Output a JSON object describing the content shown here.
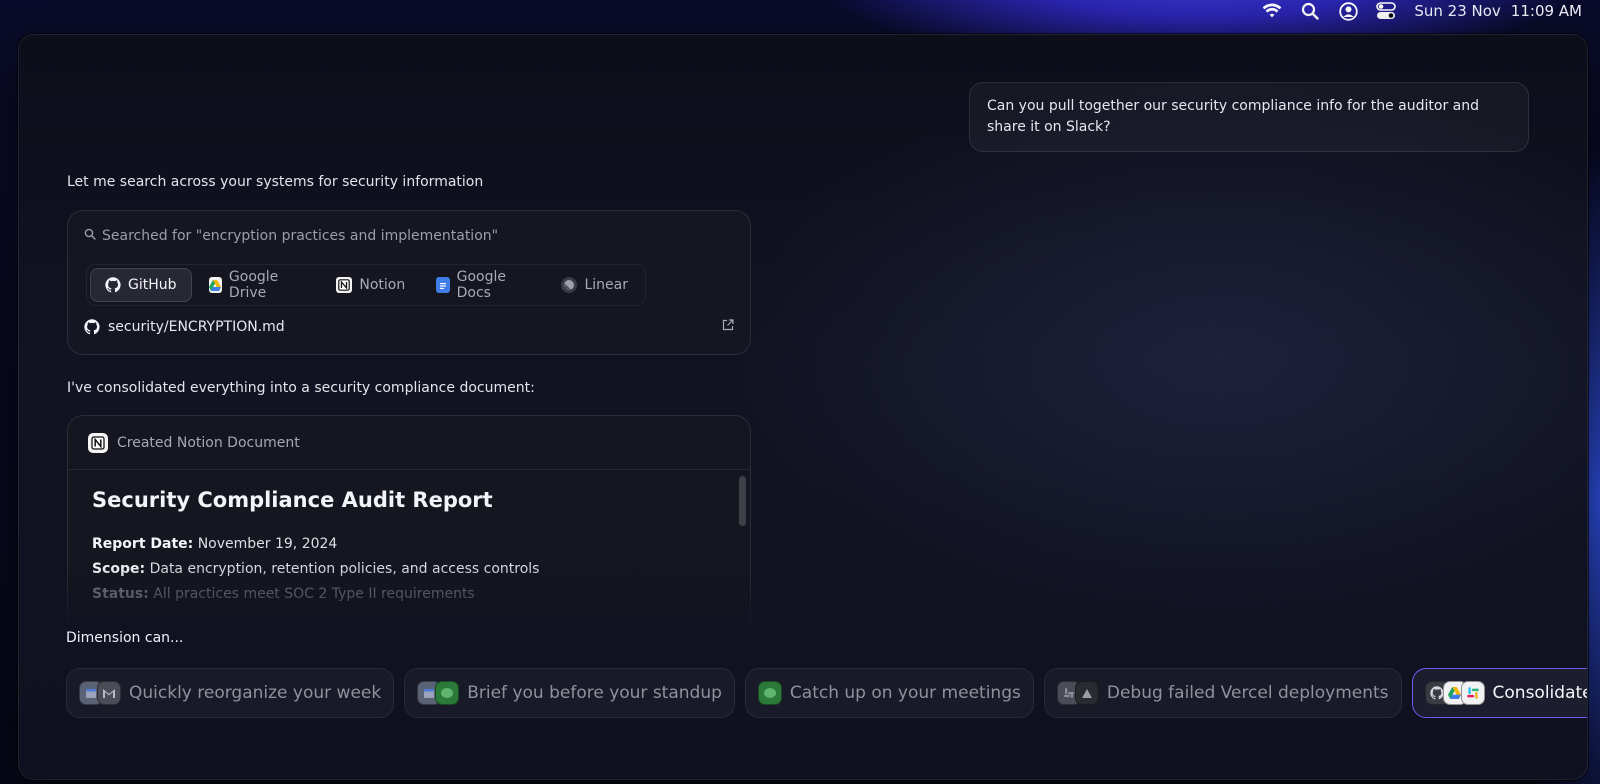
{
  "menubar": {
    "date": "Sun 23 Nov",
    "time": "11:09 AM"
  },
  "chat": {
    "user_message": "Can you pull together our security compliance info for the auditor and share it on Slack?",
    "assistant_intro": "Let me search across your systems for security information",
    "search": {
      "query_text": "Searched for \"encryption practices and implementation\"",
      "sources": [
        {
          "label": "GitHub",
          "icon": "github-icon",
          "active": true
        },
        {
          "label": "Google Drive",
          "icon": "google-drive-icon",
          "active": false
        },
        {
          "label": "Notion",
          "icon": "notion-icon",
          "active": false
        },
        {
          "label": "Google Docs",
          "icon": "google-docs-icon",
          "active": false
        },
        {
          "label": "Linear",
          "icon": "linear-icon",
          "active": false
        }
      ],
      "result_file": "security/ENCRYPTION.md"
    },
    "assistant_followup": "I've consolidated everything into a security compliance document:",
    "document": {
      "header": "Created Notion Document",
      "title": "Security Compliance Audit Report",
      "lines": [
        {
          "label": "Report Date:",
          "value": "November 19, 2024"
        },
        {
          "label": "Scope:",
          "value": "Data encryption, retention policies, and access controls"
        },
        {
          "label": "Status:",
          "value": "All practices meet SOC 2 Type II requirements"
        }
      ]
    }
  },
  "suggestions": {
    "heading": "Dimension can...",
    "items": [
      {
        "label": "Quickly reorganize your week",
        "icons": [
          "calendar-icon",
          "gmail-icon"
        ]
      },
      {
        "label": "Brief you before your standup",
        "icons": [
          "calendar-icon",
          "google-meet-icon"
        ]
      },
      {
        "label": "Catch up on your meetings",
        "icons": [
          "google-meet-icon"
        ]
      },
      {
        "label": "Debug failed Vercel deployments",
        "icons": [
          "slack-icon",
          "vercel-icon"
        ]
      },
      {
        "label": "Consolidate scattered",
        "icons": [
          "github-icon",
          "google-drive-icon",
          "slack-icon"
        ]
      }
    ]
  },
  "colors": {
    "accent_border": "#6b5cf0",
    "window_bg": "#0f1120",
    "wallpaper_blue": "#3f3bd6"
  }
}
